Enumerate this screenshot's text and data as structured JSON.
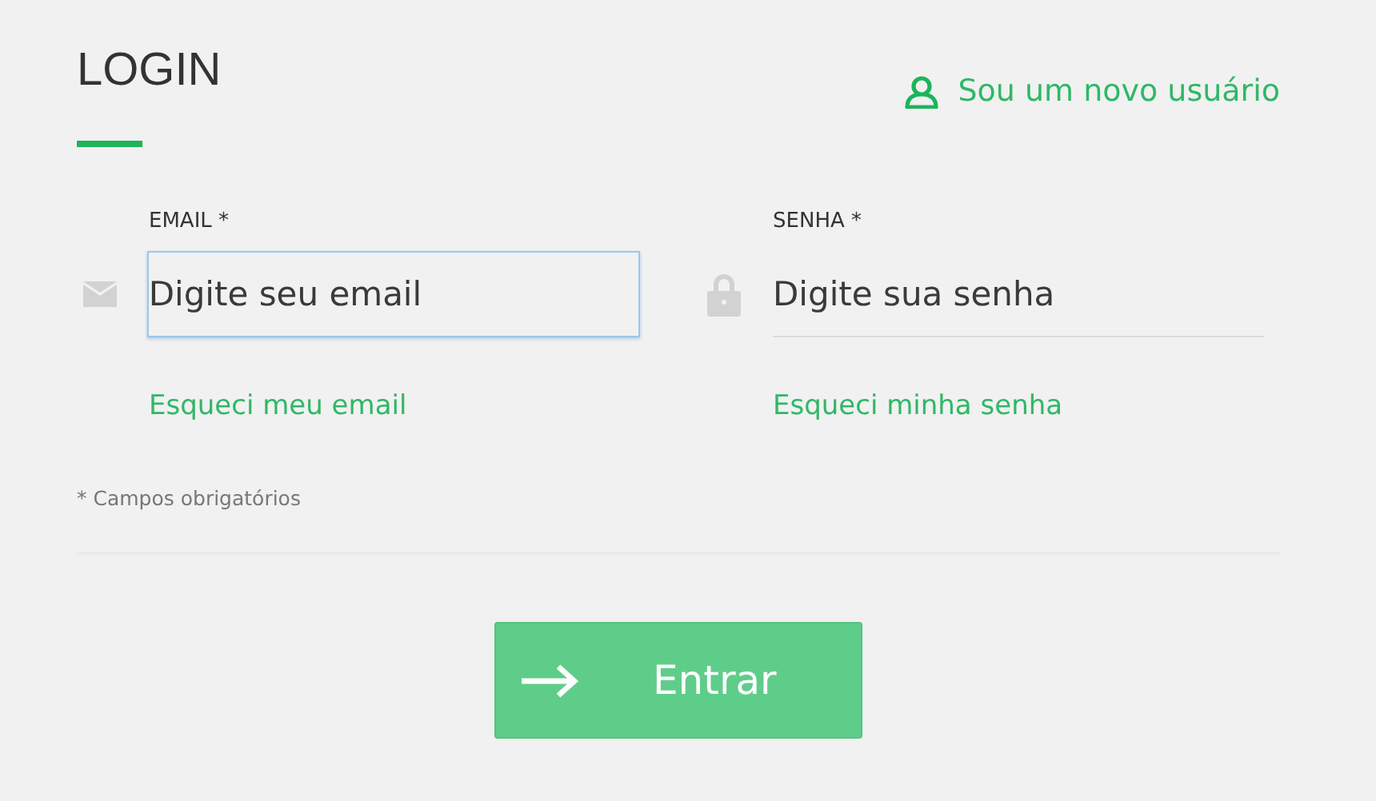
{
  "title": "LOGIN",
  "new_user_link": "Sou um novo usuário",
  "fields": [
    {
      "kind": "email",
      "label": "EMAIL *",
      "placeholder": "Digite seu email",
      "focused": true,
      "link": "Esqueci meu email"
    },
    {
      "kind": "password",
      "label": "SENHA *",
      "placeholder": "Digite sua senha",
      "focused": false,
      "link": "Esqueci minha senha"
    }
  ],
  "required_note": "* Campos obrigatórios",
  "submit_button": "Entrar"
}
